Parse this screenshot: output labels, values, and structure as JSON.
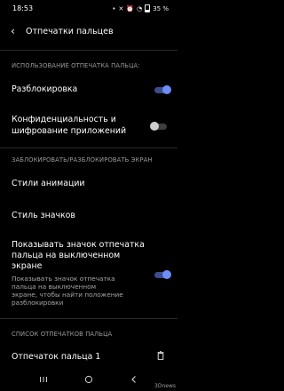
{
  "status_bar": {
    "time": "18:53",
    "battery": "35 %",
    "icons": [
      "notification-dot-icon",
      "mute-icon",
      "alarm-icon",
      "wifi-icon",
      "battery-icon"
    ]
  },
  "appbar": {
    "title": "Отпечатки пальцев",
    "back_icon": "arrow-left-icon"
  },
  "sections": {
    "usage": "ИСПОЛЬЗОВАНИЕ ОТПЕЧАТКА ПАЛЬЦА:",
    "lock": "ЗАБЛОКИРОВАТЬ/РАЗБЛОКИРОВАТЬ ЭКРАН",
    "list": "СПИСОК ОТПЕЧАТКОВ ПАЛЬЦА"
  },
  "items": {
    "unlock": {
      "label": "Разблокировка",
      "toggle": true
    },
    "privacy": {
      "label_line1": "Конфиденциальность и",
      "label_line2": "шифрование приложений",
      "toggle": false
    },
    "animation": {
      "label": "Стили анимации"
    },
    "icons_style": {
      "label": "Стиль значков"
    },
    "screen_off": {
      "label_line1": "Показывать значок отпечатка",
      "label_line2": "пальца на выключенном",
      "label_line3": "экране",
      "desc_line1": "Показывать значок отпечатка",
      "desc_line2": "пальца на выключенном",
      "desc_line3": "экране, чтобы найти положение",
      "desc_line4": "разблокировки",
      "toggle": true
    },
    "fingerprint1": {
      "label": "Отпечаток пальца 1",
      "icon": "trash-icon"
    }
  },
  "nav": {
    "icons": [
      "menu-icon",
      "home-icon",
      "back-icon"
    ]
  },
  "watermark": "3Dnews"
}
